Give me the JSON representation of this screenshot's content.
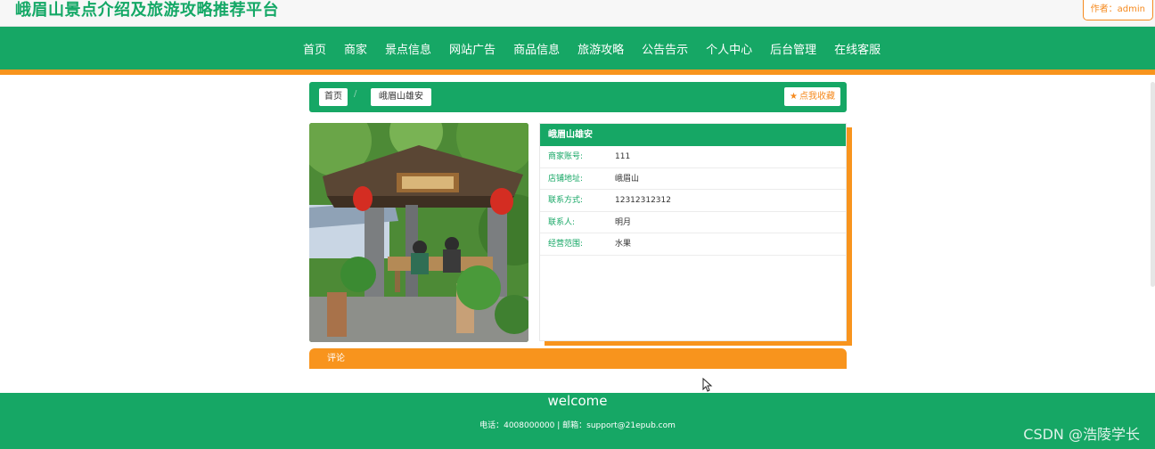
{
  "header": {
    "site_title": "峨眉山景点介绍及旅游攻略推荐平台",
    "author_badge": "作者：admin"
  },
  "nav": {
    "items": [
      "首页",
      "商家",
      "景点信息",
      "网站广告",
      "商品信息",
      "旅游攻略",
      "公告告示",
      "个人中心",
      "后台管理",
      "在线客服"
    ]
  },
  "breadcrumb": {
    "home": "首页",
    "separator": "/",
    "current": "峨眉山雄安",
    "favorite": "点我收藏"
  },
  "detail": {
    "title": "峨眉山雄安",
    "rows": [
      {
        "label": "商家账号:",
        "value": "111"
      },
      {
        "label": "店铺地址:",
        "value": "峨眉山"
      },
      {
        "label": "联系方式:",
        "value": "12312312312"
      },
      {
        "label": "联系人:",
        "value": "明月"
      },
      {
        "label": "经营范围:",
        "value": "水果"
      }
    ]
  },
  "comment": {
    "label": "评论"
  },
  "footer": {
    "title": "welcome",
    "contact": "电话：4008000000 | 邮箱：support@21epub.com"
  },
  "watermark": "CSDN @浩陵学长",
  "colors": {
    "primary_green": "#16a765",
    "accent_orange": "#f8941d"
  }
}
